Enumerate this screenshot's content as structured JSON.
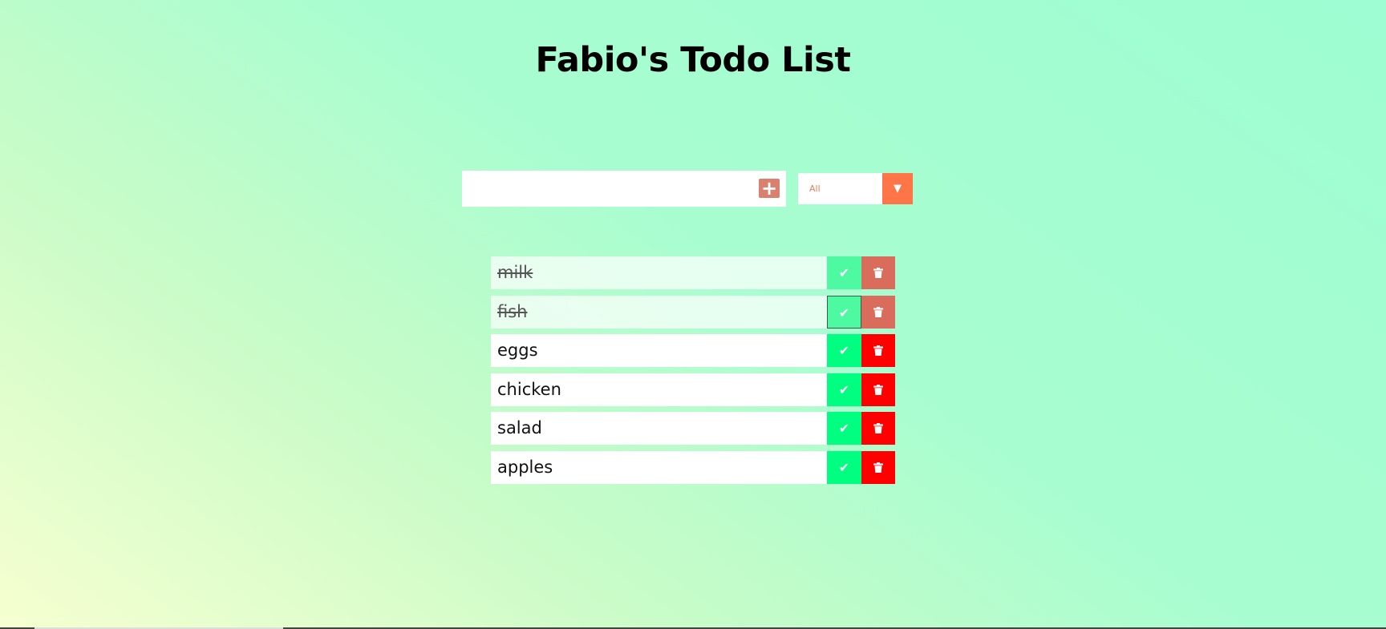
{
  "header": {
    "title": "Fabio's Todo List"
  },
  "form": {
    "input_value": "",
    "add_icon": "plus-square-icon",
    "filter": {
      "selected": "All",
      "icon": "caret-down-icon"
    }
  },
  "todos": [
    {
      "text": "milk",
      "completed": true
    },
    {
      "text": "fish",
      "completed": true
    },
    {
      "text": "eggs",
      "completed": false
    },
    {
      "text": "chicken",
      "completed": false
    },
    {
      "text": "salad",
      "completed": false
    },
    {
      "text": "apples",
      "completed": false
    }
  ],
  "icons": {
    "check": "check-icon",
    "trash": "trash-icon"
  },
  "colors": {
    "check": "#00ff80",
    "trash": "#ff0000",
    "filter_arrow": "#ff7548",
    "add_button": "#d9806f"
  }
}
